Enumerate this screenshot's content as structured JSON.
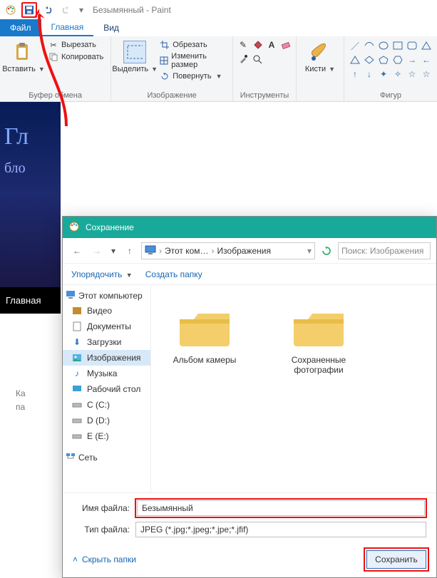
{
  "titlebar": {
    "document_name": "Безымянный",
    "app_name": "Paint"
  },
  "tabs": {
    "file": "Файл",
    "home": "Главная",
    "view": "Вид"
  },
  "ribbon": {
    "clipboard": {
      "paste": "Вставить",
      "cut": "Вырезать",
      "copy": "Копировать",
      "group_label": "Буфер обмена"
    },
    "image": {
      "select": "Выделить",
      "crop": "Обрезать",
      "resize": "Изменить размер",
      "rotate": "Повернуть",
      "group_label": "Изображение"
    },
    "tools": {
      "group_label": "Инструменты"
    },
    "brushes": {
      "label": "Кисти"
    },
    "shapes": {
      "group_label": "Фигур"
    }
  },
  "canvas": {
    "text1": "Гл",
    "text2": "бло",
    "nav": "Главная",
    "meta1": "Ка",
    "meta2": "па"
  },
  "dialog": {
    "title": "Сохранение",
    "breadcrumb": {
      "root": "Этот ком…",
      "folder": "Изображения"
    },
    "search_placeholder": "Поиск: Изображения",
    "toolbar": {
      "organize": "Упорядочить",
      "new_folder": "Создать папку"
    },
    "tree": {
      "this_pc": "Этот компьютер",
      "videos": "Видео",
      "documents": "Документы",
      "downloads": "Загрузки",
      "pictures": "Изображения",
      "music": "Музыка",
      "desktop": "Рабочий стол",
      "drive_c": "C (C:)",
      "drive_d": "D (D:)",
      "drive_e": "E (E:)",
      "network": "Сеть"
    },
    "folders": {
      "camera_roll": "Альбом камеры",
      "saved_pictures": "Сохраненные фотографии"
    },
    "fields": {
      "filename_label": "Имя файла:",
      "filename_value": "Безымянный",
      "filetype_label": "Тип файла:",
      "filetype_value": "JPEG (*.jpg;*.jpeg;*.jpe;*.jfif)"
    },
    "footer": {
      "hide_folders": "Скрыть папки",
      "save": "Сохранить"
    }
  },
  "annotations": {
    "save_icon_highlighted": true,
    "filename_highlighted": true,
    "save_button_highlighted": true,
    "red_arrow_from_save_icon": true
  }
}
